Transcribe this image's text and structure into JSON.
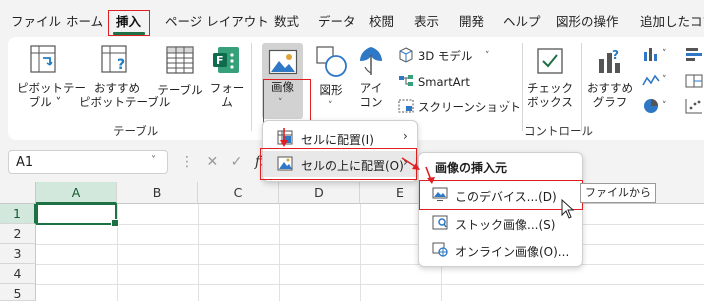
{
  "tabs": [
    "ファイル",
    "ホーム",
    "挿入",
    "ページ レイアウト",
    "数式",
    "データ",
    "校閲",
    "表示",
    "開発",
    "ヘルプ",
    "図形の操作",
    "追加したコマ"
  ],
  "ribbon": {
    "pivot_label": "ピボットテー\nブル ˅",
    "rec_pivot_label": "おすすめ\nピボットテーブル",
    "table_label": "テーブル",
    "form_label": "フォー\nム",
    "tables_group": "テーブル",
    "image_label": "画像",
    "shapes_label": "図形",
    "icons_label": "アイ\nコン",
    "model3d_label": "3D モデル",
    "smartart_label": "SmartArt",
    "screenshot_label": "スクリーンショット",
    "checkbox_label": "チェック\nボックス",
    "controls_group": "コントロール",
    "rec_charts_label": "おすすめ\nグラフ"
  },
  "formula_bar": {
    "namebox_value": "A1",
    "fx": "fx"
  },
  "grid": {
    "columns": [
      "A",
      "B",
      "C",
      "D",
      "E"
    ],
    "rows": [
      "1",
      "2",
      "3",
      "4",
      "5"
    ]
  },
  "image_menu": {
    "item1": "セルに配置(I)",
    "item2": "セルの上に配置(O)"
  },
  "source_menu": {
    "title": "画像の挿入元",
    "this_device": "このデバイス...(D)",
    "stock": "ストック画像...(S)",
    "online": "オンライン画像(O)..."
  },
  "tooltip": "ファイルから",
  "colors": {
    "accent": "#1e7145",
    "highlight": "#e02020"
  }
}
